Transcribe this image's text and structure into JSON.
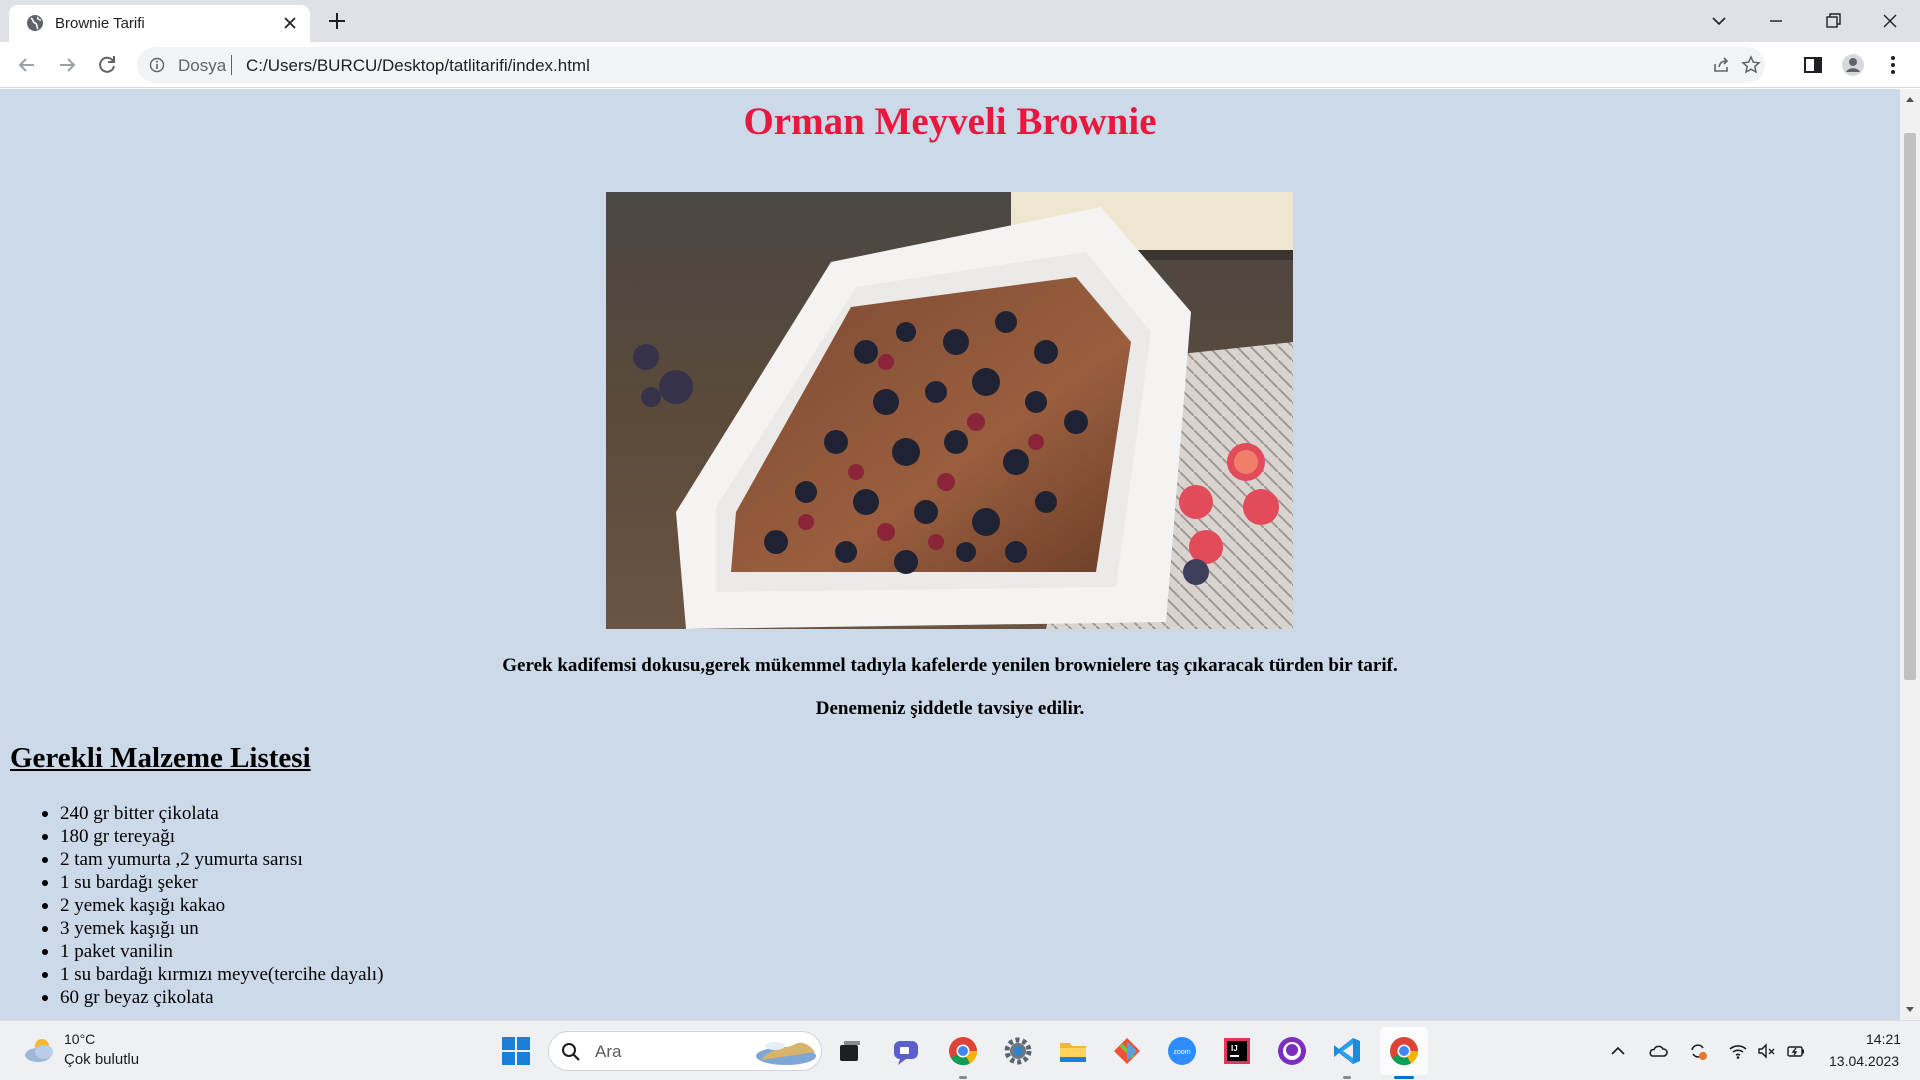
{
  "browser": {
    "tab_title": "Brownie Tarifi",
    "address_scheme": "Dosya",
    "address_url": "C:/Users/BURCU/Desktop/tatlitarifi/index.html"
  },
  "page": {
    "title": "Orman Meyveli Brownie",
    "description_1": "Gerek kadifemsi dokusu,gerek mükemmel tadıyla kafelerde yenilen brownielere taş çıkaracak türden bir tarif.",
    "description_2": "Denemeniz şiddetle tavsiye edilir.",
    "ingredients_heading": "Gerekli Malzeme Listesi",
    "ingredients": [
      "240 gr bitter çikolata",
      "180 gr tereyağı",
      "2 tam yumurta ,2 yumurta sarısı",
      "1 su bardağı şeker",
      "2 yemek kaşığı kakao",
      "3 yemek kaşığı un",
      "1 paket vanilin",
      "1 su bardağı kırmızı meyve(tercihe dayalı)",
      "60 gr beyaz çikolata"
    ]
  },
  "taskbar": {
    "weather_temp": "10°C",
    "weather_desc": "Çok bulutlu",
    "search_label": "Ara",
    "clock_time": "14:21",
    "clock_date": "13.04.2023",
    "apps": [
      "windows-start-icon",
      "task-view-icon",
      "teams-chat-icon",
      "chrome-icon",
      "settings-icon",
      "file-explorer-icon",
      "git-icon",
      "zoom-icon",
      "intellij-icon",
      "github-desktop-icon",
      "vscode-icon",
      "chrome-active-icon"
    ]
  },
  "colors": {
    "page_background": "#ccd9e8",
    "title_color": "#e8173d",
    "tabstrip": "#dee1e6"
  }
}
